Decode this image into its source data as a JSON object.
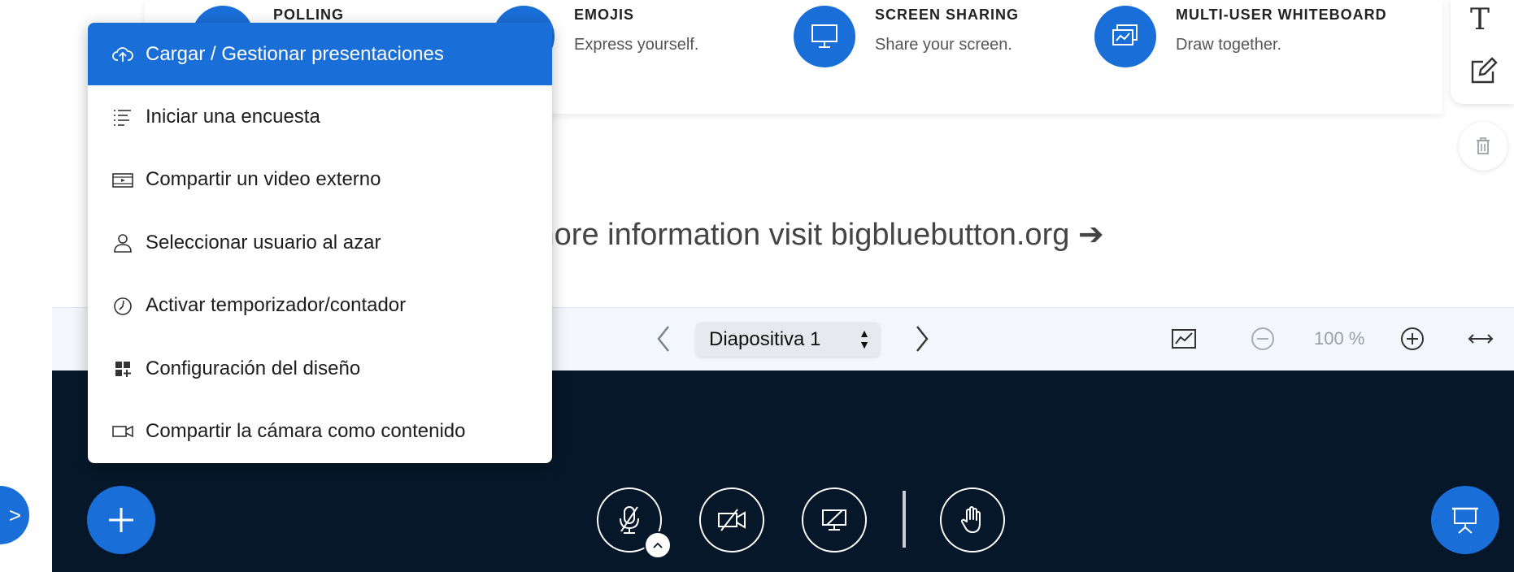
{
  "features": [
    {
      "title": "POLLING",
      "description": "",
      "icon": "poll-icon"
    },
    {
      "title": "EMOJIS",
      "description": "Express yourself.",
      "icon": "emoji-icon"
    },
    {
      "title": "SCREEN SHARING",
      "description": "Share your screen.",
      "icon": "monitor-icon"
    },
    {
      "title": "MULTI-USER WHITEBOARD",
      "description": "Draw together.",
      "icon": "whiteboard-icon"
    }
  ],
  "info_text": "more information visit bigbluebutton.org",
  "info_arrow": "➔",
  "tools": {
    "text_tool": "T"
  },
  "slide_nav": {
    "selected_slide": "Diapositiva 1",
    "zoom": "100 %"
  },
  "menu": {
    "items": [
      {
        "label": "Cargar / Gestionar presentaciones",
        "icon": "upload-cloud-icon",
        "active": true
      },
      {
        "label": "Iniciar una encuesta",
        "icon": "list-icon"
      },
      {
        "label": "Compartir un video externo",
        "icon": "video-film-icon"
      },
      {
        "label": "Seleccionar usuario al azar",
        "icon": "user-icon"
      },
      {
        "label": "Activar temporizador/contador",
        "icon": "clock-icon"
      },
      {
        "label": "Configuración del diseño",
        "icon": "layout-grid-icon"
      },
      {
        "label": "Compartir la cámara como contenido",
        "icon": "camera-icon"
      }
    ]
  },
  "colors": {
    "accent": "#1a6ed8",
    "action_bar": "#06172a",
    "nav_bar": "#f3f6fa"
  }
}
